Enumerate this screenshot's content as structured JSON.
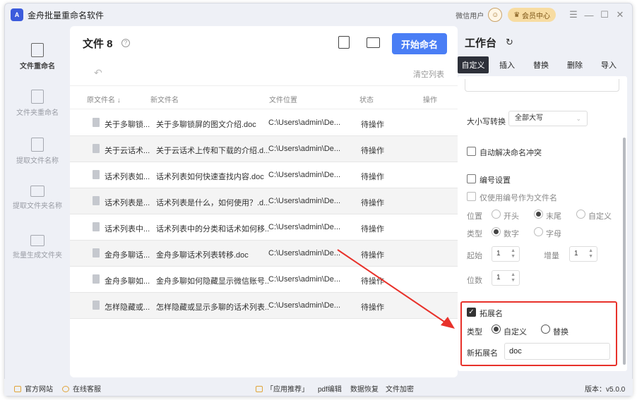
{
  "app": {
    "title": "金舟批量重命名软件",
    "logo_text": "A"
  },
  "titlebar": {
    "user_label": "微信用户",
    "vip_button": "会员中心",
    "controls": [
      "☰",
      "—",
      "☐",
      "✕"
    ]
  },
  "sidebar": {
    "items": [
      {
        "label": "文件重命名",
        "active": true
      },
      {
        "label": "文件夹重命名",
        "active": false
      },
      {
        "label": "提取文件名称",
        "active": false
      },
      {
        "label": "提取文件夹名称",
        "active": false
      },
      {
        "label": "批量生成文件夹",
        "active": false
      }
    ]
  },
  "main": {
    "title": "文件 8",
    "help_icon": "?",
    "start_button": "开始命名",
    "undo_icon": "↶",
    "clear_button": "清空列表",
    "columns": [
      "原文件名 ↓",
      "新文件名",
      "文件位置",
      "状态",
      "操作"
    ],
    "rows": [
      {
        "original": "关于多聊锁...",
        "new_name": "关于多聊锁屏的图文介绍.doc",
        "location": "C:\\Users\\admin\\De...",
        "status": "待操作"
      },
      {
        "original": "关于云话术...",
        "new_name": "关于云话术上传和下载的介绍.d...",
        "location": "C:\\Users\\admin\\De...",
        "status": "待操作"
      },
      {
        "original": "话术列表如...",
        "new_name": "话术列表如何快速查找内容.doc",
        "location": "C:\\Users\\admin\\De...",
        "status": "待操作"
      },
      {
        "original": "话术列表是...",
        "new_name": "话术列表是什么，如何使用？.d...",
        "location": "C:\\Users\\admin\\De...",
        "status": "待操作"
      },
      {
        "original": "话术列表中...",
        "new_name": "话术列表中的分类和话术如何移...",
        "location": "C:\\Users\\admin\\De...",
        "status": "待操作"
      },
      {
        "original": "金舟多聊话...",
        "new_name": "金舟多聊话术列表转移.doc",
        "location": "C:\\Users\\admin\\De...",
        "status": "待操作"
      },
      {
        "original": "金舟多聊如...",
        "new_name": "金舟多聊如何隐藏显示微信账号...",
        "location": "C:\\Users\\admin\\De...",
        "status": "待操作"
      },
      {
        "original": "怎样隐藏或...",
        "new_name": "怎样隐藏或显示多聊的话术列表...",
        "location": "C:\\Users\\admin\\De...",
        "status": "待操作"
      }
    ]
  },
  "workbench": {
    "title": "工作台",
    "refresh_icon": "↻",
    "tabs": [
      "自定义",
      "插入",
      "替换",
      "删除",
      "导入"
    ],
    "active_tab": "自定义",
    "case_label": "大小写转换",
    "case_value": "全部大写",
    "auto_conflict_label": "自动解决命名冲突",
    "numbering": {
      "label": "编号设置",
      "only_number_label": "仅使用编号作为文件名",
      "position_label": "位置",
      "position_options": [
        "开头",
        "末尾",
        "自定义"
      ],
      "position_selected": "末尾",
      "type_label": "类型",
      "type_options": [
        "数字",
        "字母"
      ],
      "type_selected": "数字",
      "start_label": "起始",
      "start_value": "1",
      "step_label": "增量",
      "step_value": "1",
      "digits_label": "位数",
      "digits_value": "1"
    },
    "extension": {
      "label": "拓展名",
      "checked": true,
      "type_label": "类型",
      "type_options": [
        "自定义",
        "替换"
      ],
      "type_selected": "自定义",
      "new_ext_label": "新拓展名",
      "new_ext_value": "doc"
    }
  },
  "statusbar": {
    "official_site": "官方网站",
    "online_service": "在线客服",
    "recommend": "「应用推荐」",
    "links": [
      "pdf编辑",
      "数据恢复",
      "文件加密"
    ],
    "version": "版本：v5.0.0"
  },
  "colors": {
    "accent": "#4a7ef5",
    "highlight_box": "#e8312a",
    "active_tab": "#2d3039"
  }
}
